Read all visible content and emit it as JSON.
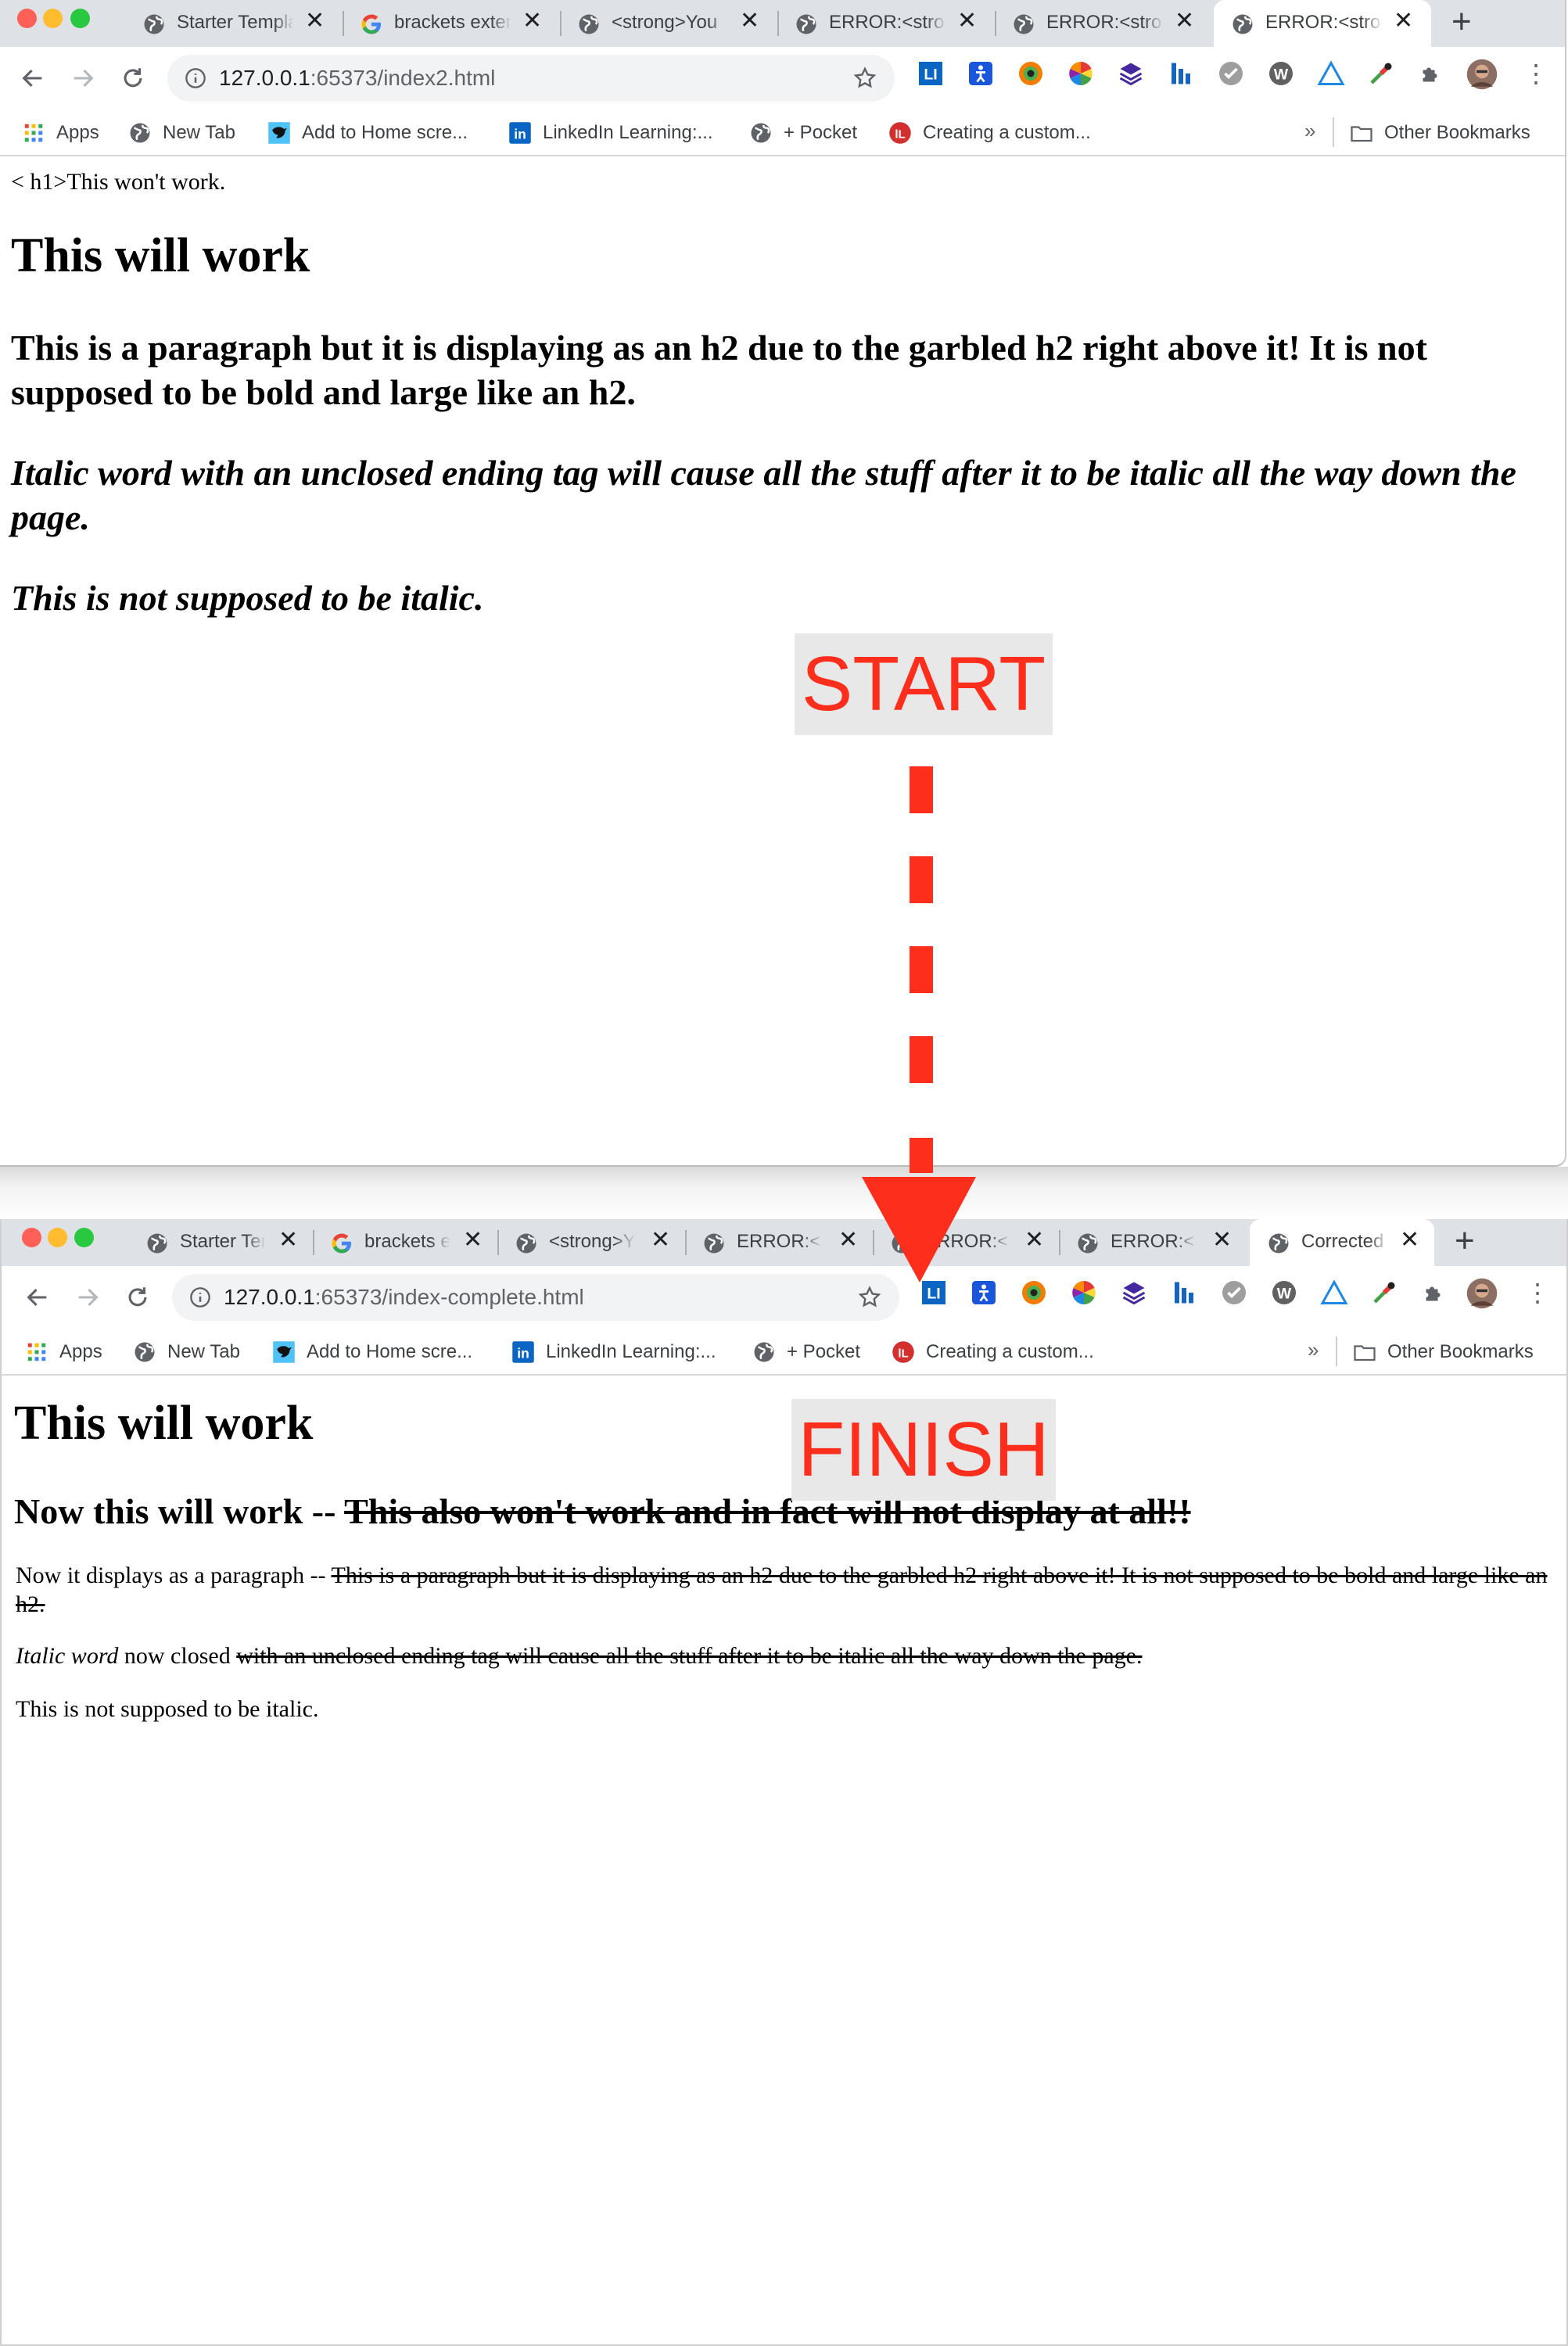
{
  "window_top": {
    "tabs": [
      {
        "title": "Starter Template",
        "icon": "globe-icon",
        "active": false
      },
      {
        "title": "brackets extension",
        "icon": "google-g-icon",
        "active": false
      },
      {
        "title": "<strong>You",
        "icon": "globe-icon",
        "active": false
      },
      {
        "title": "ERROR:<strong>",
        "icon": "globe-icon",
        "active": false
      },
      {
        "title": "ERROR:<strong>",
        "icon": "globe-icon",
        "active": false
      },
      {
        "title": "ERROR:<strong>",
        "icon": "globe-icon",
        "active": true
      }
    ],
    "url_host": "127.0.0.1",
    "url_rest": ":65373/index2.html"
  },
  "window_bottom": {
    "tabs": [
      {
        "title": "Starter Template",
        "icon": "globe-icon",
        "active": false
      },
      {
        "title": "brackets extension",
        "icon": "google-g-icon",
        "active": false
      },
      {
        "title": "<strong>You",
        "icon": "globe-icon",
        "active": false
      },
      {
        "title": "ERROR:<strong>",
        "icon": "globe-icon",
        "active": false
      },
      {
        "title": "ERROR:<strong>",
        "icon": "globe-icon",
        "active": false
      },
      {
        "title": "ERROR:<strong>",
        "icon": "globe-icon",
        "active": false
      },
      {
        "title": "Corrected",
        "icon": "globe-icon",
        "active": true
      }
    ],
    "url_host": "127.0.0.1",
    "url_rest": ":65373/index-complete.html"
  },
  "bookmarks": {
    "items": [
      "Apps",
      "New Tab",
      "Add to Home scre...",
      "LinkedIn Learning:...",
      "+ Pocket",
      "Creating a custom..."
    ],
    "overflow": "»",
    "other": "Other Bookmarks"
  },
  "page_broken": {
    "raw_tag_line": "< h1>This won't work.",
    "heading": "This will work",
    "paragraph_as_h2": "This is a paragraph but it is displaying as an h2 due to the garbled h2 right above it! It is not supposed to be bold and large like an h2.",
    "italic_runaway": "Italic word with an unclosed ending tag will cause all the stuff after it to be italic all the way down the page.",
    "not_italic": "This is not supposed to be italic."
  },
  "page_fixed": {
    "heading": "This will work",
    "h2_prefix": "Now this will work -- ",
    "h2_struck": "This also won't work and in fact will not display at all!!",
    "p1_prefix": "Now it displays as a paragraph -- ",
    "p1_struck": "This is a paragraph but it is displaying as an h2 due to the garbled h2 right above it! It is not supposed to be bold and large like an h2.",
    "p2_italic": "Italic word",
    "p2_mid": " now closed ",
    "p2_struck": "with an unclosed ending tag will cause all the stuff after it to be italic all the way down the page.",
    "p3": "This is not supposed to be italic."
  },
  "annotations": {
    "start": "START",
    "finish": "FINISH",
    "color": "#fd2e1c",
    "background": "#e8e8e8"
  },
  "theme": {
    "tabstrip": "#dee1e6",
    "omnibox": "#f1f3f4",
    "traffic_lights": [
      "#fe5f57",
      "#febc2e",
      "#28c840"
    ]
  }
}
